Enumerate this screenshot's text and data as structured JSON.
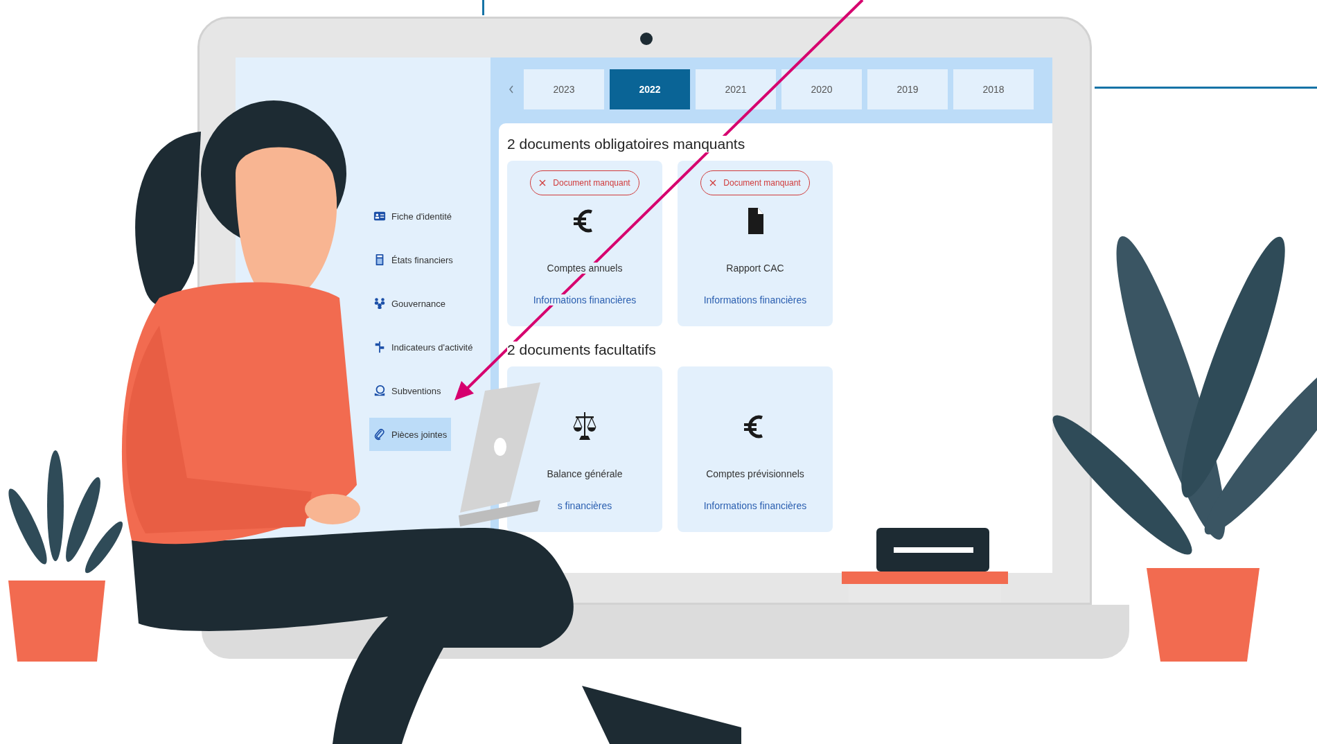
{
  "sidebar": {
    "items": [
      {
        "label": "Fiche d'identité",
        "kind": "id-card",
        "selected": false
      },
      {
        "label": "États financiers",
        "kind": "calculator",
        "selected": false
      },
      {
        "label": "Gouvernance",
        "kind": "people",
        "selected": false
      },
      {
        "label": "Indicateurs d'activité",
        "kind": "signpost",
        "selected": false
      },
      {
        "label": "Subventions",
        "kind": "money-hand",
        "selected": false
      },
      {
        "label": "Pièces jointes",
        "kind": "paperclip",
        "selected": true
      }
    ]
  },
  "year_tabs": [
    {
      "label": "2023",
      "selected": false
    },
    {
      "label": "2022",
      "selected": true
    },
    {
      "label": "2021",
      "selected": false
    },
    {
      "label": "2020",
      "selected": false
    },
    {
      "label": "2019",
      "selected": false
    },
    {
      "label": "2018",
      "selected": false
    }
  ],
  "sections": [
    {
      "heading": "2 documents obligatoires manquants",
      "cards": [
        {
          "badge": "Document manquant",
          "missing": true,
          "kind": "euro",
          "title": "Comptes annuels",
          "category": "Informations financières"
        },
        {
          "badge": "Document manquant",
          "missing": true,
          "kind": "file",
          "title": "Rapport CAC",
          "category": "Informations financières"
        }
      ]
    },
    {
      "heading": "2 documents facultatifs",
      "cards": [
        {
          "missing": false,
          "kind": "scale",
          "title": "Balance générale",
          "category": "s financières"
        },
        {
          "missing": false,
          "kind": "euro",
          "title": "Comptes prévisionnels",
          "category": "Informations financières"
        }
      ]
    }
  ]
}
